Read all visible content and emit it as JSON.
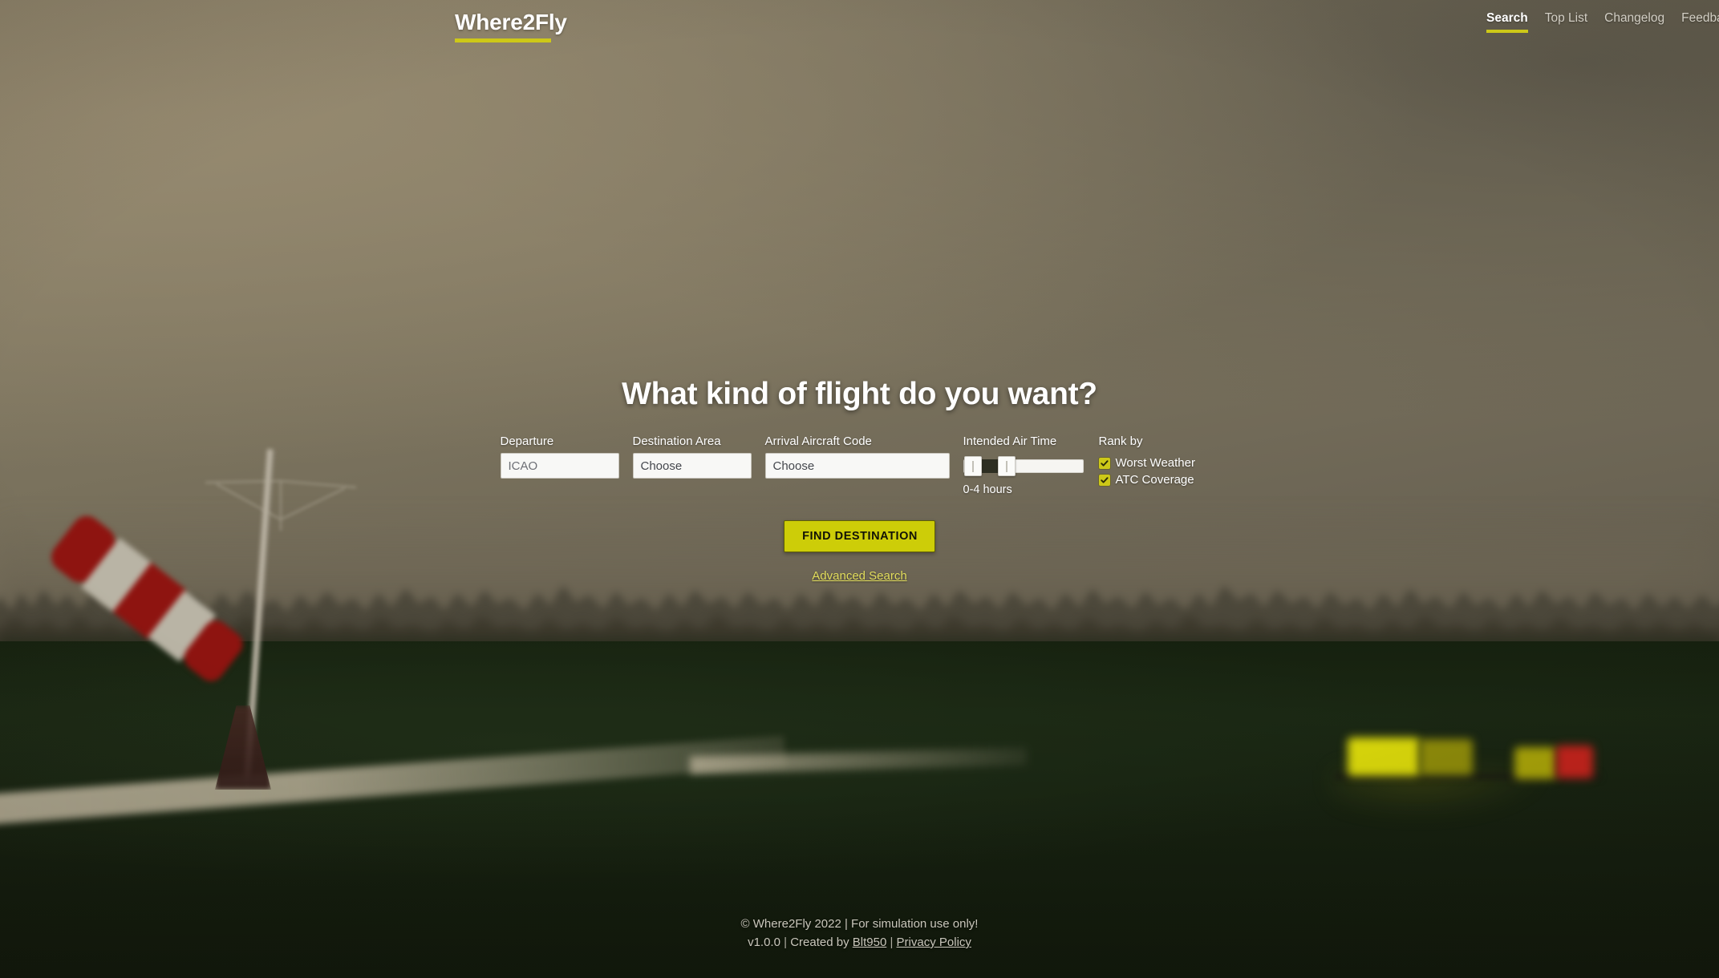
{
  "header": {
    "brand": "Where2Fly",
    "nav": [
      {
        "label": "Search",
        "active": true
      },
      {
        "label": "Top List",
        "active": false
      },
      {
        "label": "Changelog",
        "active": false
      },
      {
        "label": "Feedback",
        "active": false
      }
    ]
  },
  "hero": {
    "title": "What kind of flight do you want?"
  },
  "search": {
    "departure": {
      "label": "Departure",
      "placeholder": "ICAO",
      "value": ""
    },
    "destination": {
      "label": "Destination Area",
      "selected": "Choose"
    },
    "aircraft": {
      "label": "Arrival Aircraft Code",
      "selected": "Choose"
    },
    "airtime": {
      "label": "Intended Air Time",
      "caption": "0-4 hours",
      "min_value": 0,
      "max_value": 4
    },
    "rank": {
      "label": "Rank by",
      "options": [
        {
          "label": "Worst Weather",
          "checked": true
        },
        {
          "label": "ATC Coverage",
          "checked": true
        }
      ]
    },
    "submit_label": "FIND DESTINATION",
    "advanced_label": "Advanced Search"
  },
  "footer": {
    "line1": "© Where2Fly 2022 | For simulation use only!",
    "version": "v1.0.0",
    "created_by_prefix": "Created by",
    "author": "Blt950",
    "privacy": "Privacy Policy",
    "separator": "|"
  },
  "colors": {
    "accent_yellow": "#cdc818",
    "button_yellow": "#cdcd08",
    "link_yellow": "#e2dd5c",
    "background_sky": "#837a63",
    "background_grass": "#16210f"
  },
  "icons": {
    "check": "check-icon"
  }
}
